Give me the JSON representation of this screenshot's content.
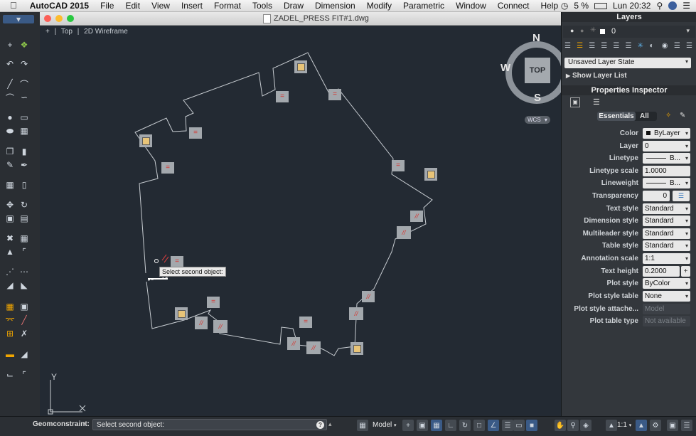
{
  "menubar": {
    "app": "AutoCAD 2015",
    "items": [
      "File",
      "Edit",
      "View",
      "Insert",
      "Format",
      "Tools",
      "Draw",
      "Dimension",
      "Modify",
      "Parametric",
      "Window",
      "Connect",
      "Help"
    ],
    "battery": "5 %",
    "clock": "Lun 20:32"
  },
  "window": {
    "title": "ZADEL_PRESS FIT#1.dwg",
    "view_plus": "+",
    "view_name": "Top",
    "visual_style": "2D Wireframe"
  },
  "viewcube": {
    "top": "TOP",
    "north": "N",
    "south": "S",
    "west": "W",
    "wcs": "WCS"
  },
  "canvas": {
    "tooltip": "Select second object:",
    "constraint_glyph_equal": "=",
    "constraint_glyph_parallel": "//",
    "axis_y": "Y"
  },
  "layers": {
    "header": "Layers",
    "current_layer": "0",
    "layer_state": "Unsaved Layer State",
    "show_list": "Show Layer List"
  },
  "properties": {
    "header": "Properties Inspector",
    "tab_essentials": "Essentials",
    "tab_all": "All",
    "rows": [
      {
        "label": "Color",
        "value": "ByLayer"
      },
      {
        "label": "Layer",
        "value": "0"
      },
      {
        "label": "Linetype",
        "value": "B..."
      },
      {
        "label": "Linetype scale",
        "value": "1.0000"
      },
      {
        "label": "Lineweight",
        "value": "B..."
      },
      {
        "label": "Transparency",
        "value": "0"
      },
      {
        "label": "Text style",
        "value": "Standard"
      },
      {
        "label": "Dimension style",
        "value": "Standard"
      },
      {
        "label": "Multileader style",
        "value": "Standard"
      },
      {
        "label": "Table style",
        "value": "Standard"
      },
      {
        "label": "Annotation scale",
        "value": "1:1"
      },
      {
        "label": "Text height",
        "value": "0.2000"
      },
      {
        "label": "Plot style",
        "value": "ByColor"
      },
      {
        "label": "Plot style table",
        "value": "None"
      },
      {
        "label": "Plot style attache...",
        "value": "Model"
      },
      {
        "label": "Plot table type",
        "value": "Not available"
      }
    ]
  },
  "statusbar": {
    "command_label": "Geomconstraint:",
    "command_prompt": "Select second object:",
    "help": "?",
    "model": "Model",
    "scale": "1:1"
  }
}
